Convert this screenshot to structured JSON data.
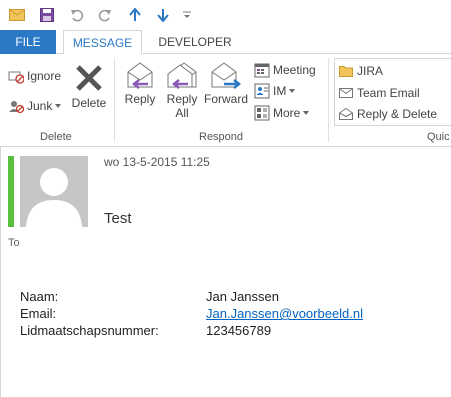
{
  "quick_access": {
    "icons": [
      "mail-icon",
      "save-icon",
      "undo-icon",
      "redo-icon",
      "up-arrow-icon",
      "down-arrow-icon",
      "customize-icon"
    ]
  },
  "tabs": {
    "file": "FILE",
    "message": "MESSAGE",
    "developer": "DEVELOPER"
  },
  "ribbon": {
    "delete_group": {
      "label": "Delete",
      "ignore": "Ignore",
      "junk": "Junk",
      "delete": "Delete"
    },
    "respond_group": {
      "label": "Respond",
      "reply": "Reply",
      "reply_all_line1": "Reply",
      "reply_all_line2": "All",
      "forward": "Forward",
      "meeting": "Meeting",
      "im": "IM",
      "more": "More"
    },
    "quick_steps": {
      "label": "Quic",
      "items": [
        "JIRA",
        "Team Email",
        "Reply & Delete"
      ]
    }
  },
  "message": {
    "date": "wo 13-5-2015 11:25",
    "subject": "Test",
    "to_label": "To",
    "fields": [
      {
        "label": "Naam:",
        "value": "Jan Janssen",
        "is_link": false
      },
      {
        "label": "Email:",
        "value": "Jan.Janssen@voorbeeld.nl",
        "is_link": true
      },
      {
        "label": "Lidmaatschapsnummer:",
        "value": "123456789",
        "is_link": false
      }
    ]
  },
  "colors": {
    "accent": "#2b79c6",
    "category_bar": "#5bbf3e",
    "link": "#0563c1"
  }
}
